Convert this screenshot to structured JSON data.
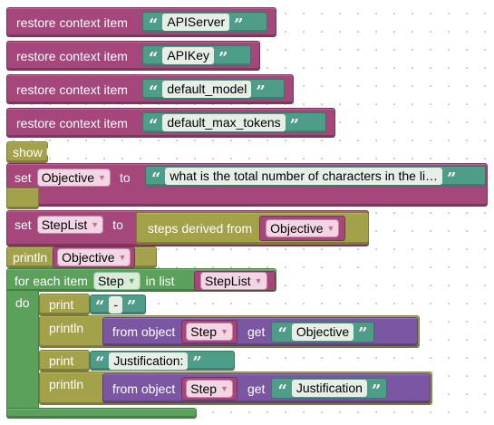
{
  "colors": {
    "variables": "#a5477a",
    "procedures": "#a3a14a",
    "loops": "#5ba05b",
    "objects": "#7a56a3",
    "text": "#4e9d88"
  },
  "blocks": {
    "restore1": {
      "label": "restore context item",
      "value": "APIServer"
    },
    "restore2": {
      "label": "restore context item",
      "value": "APIKey"
    },
    "restore3": {
      "label": "restore context item",
      "value": "default_model"
    },
    "restore4": {
      "label": "restore context item",
      "value": "default_max_tokens"
    },
    "show_ui": {
      "label": "show UI"
    },
    "set_objective": {
      "set": "set",
      "var": "Objective",
      "to": "to",
      "value": "what is the total number of characters in the li…"
    },
    "set_steplist": {
      "set": "set",
      "var": "StepList",
      "to": "to",
      "label": "steps derived from",
      "arg": "Objective"
    },
    "println_objective": {
      "label": "println",
      "var": "Objective"
    },
    "foreach": {
      "for_each": "for each item",
      "var": "Step",
      "in_list": "in list",
      "list": "StepList",
      "do": "do",
      "print1": {
        "label": "print",
        "value": "-"
      },
      "println1": {
        "label": "println",
        "from": "from object",
        "obj": "Step",
        "get": "get",
        "key": "Objective"
      },
      "print2": {
        "label": "print",
        "value": "Justification:"
      },
      "println2": {
        "label": "println",
        "from": "from object",
        "obj": "Step",
        "get": "get",
        "key": "Justification"
      }
    }
  }
}
